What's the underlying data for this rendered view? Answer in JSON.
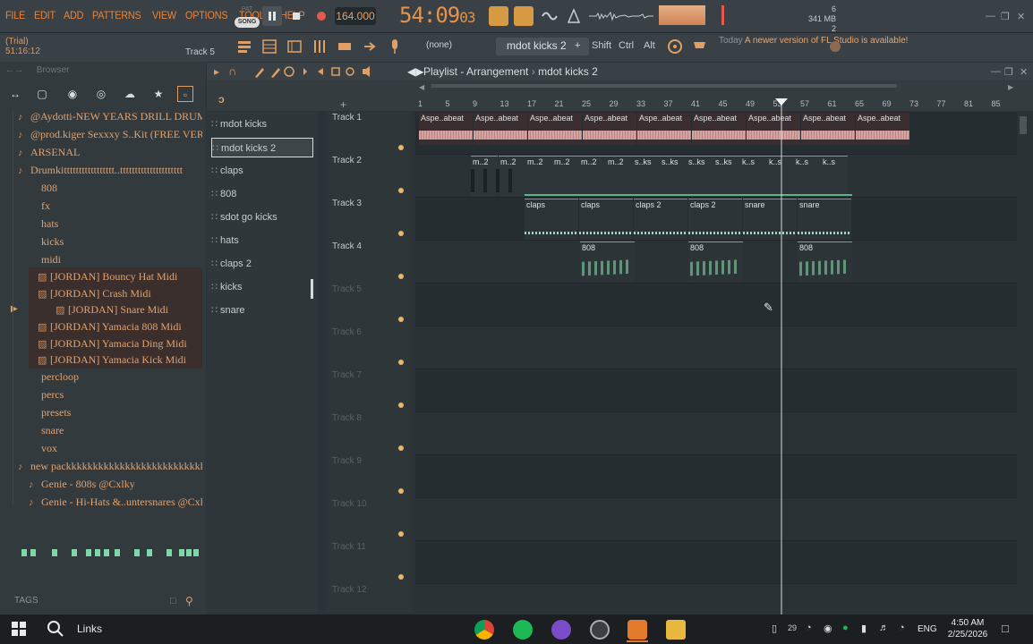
{
  "menu": [
    "FILE",
    "EDIT",
    "ADD",
    "PATTERNS",
    "VIEW",
    "OPTIONS",
    "TOOLS",
    "HELP"
  ],
  "trial": {
    "label": "(Trial)",
    "position": "51:16:12"
  },
  "mode": {
    "pat": "PAT",
    "song": "SONG"
  },
  "tempo": "164.000",
  "time": {
    "main": "54:09",
    "sub": "03"
  },
  "cpu": {
    "cpu_value": "6",
    "memory": "341 MB",
    "polyphony": "2"
  },
  "toolbar": {
    "current_track": "Track 5",
    "none_label": "(none)",
    "pattern_name": "mdot kicks 2",
    "keys": [
      "Shift",
      "Ctrl",
      "Alt"
    ]
  },
  "news": {
    "prefix": "Today",
    "text": "A newer version of FL Studio is available!"
  },
  "browser": {
    "title": "Browser",
    "tags_label": "TAGS",
    "tree": [
      {
        "label": "@Aydotti-NEW YEARS DRILL DRUMKIT",
        "icon": "note-icon",
        "depth": 0
      },
      {
        "label": "@prod.kiger Sexxxy S..Kit (FREE VERSION)",
        "icon": "note-icon",
        "depth": 0
      },
      {
        "label": "ARSENAL",
        "icon": "note-icon",
        "depth": 0
      },
      {
        "label": "Drumkittttttttttttttttt..ttttttttttttttttttttt",
        "icon": "note-icon",
        "depth": 0
      },
      {
        "label": "808",
        "icon": "folder-icon",
        "depth": 1
      },
      {
        "label": "fx",
        "icon": "folder-icon",
        "depth": 1
      },
      {
        "label": "hats",
        "icon": "folder-icon",
        "depth": 1
      },
      {
        "label": "kicks",
        "icon": "folder-icon",
        "depth": 1
      },
      {
        "label": "midi",
        "icon": "folder-icon",
        "depth": 1
      },
      {
        "label": "[JORDAN] Bouncy Hat Midi",
        "icon": "midi-icon",
        "depth": 2
      },
      {
        "label": "[JORDAN] Crash Midi",
        "icon": "midi-icon",
        "depth": 2
      },
      {
        "label": "[JORDAN] Snare Midi",
        "icon": "midi-icon",
        "depth": 2,
        "selected": true
      },
      {
        "label": "[JORDAN] Yamacia 808 Midi",
        "icon": "midi-icon",
        "depth": 2
      },
      {
        "label": "[JORDAN] Yamacia Ding Midi",
        "icon": "midi-icon",
        "depth": 2
      },
      {
        "label": "[JORDAN] Yamacia Kick Midi",
        "icon": "midi-icon",
        "depth": 2
      },
      {
        "label": "percloop",
        "icon": "folder-icon",
        "depth": 1
      },
      {
        "label": "percs",
        "icon": "folder-icon",
        "depth": 1
      },
      {
        "label": "presets",
        "icon": "folder-icon",
        "depth": 1
      },
      {
        "label": "snare",
        "icon": "folder-icon",
        "depth": 1
      },
      {
        "label": "vox",
        "icon": "folder-icon",
        "depth": 1
      },
      {
        "label": "new packkkkkkkkkkkkkkkkkkkkkkkkkkk",
        "icon": "note-icon",
        "depth": 0
      },
      {
        "label": "Genie - 808s @Cxlky",
        "icon": "note-icon",
        "depth": 1
      },
      {
        "label": "Genie - Hi-Hats &..untersnares @Cxlky",
        "icon": "note-icon",
        "depth": 1
      }
    ]
  },
  "picker": [
    {
      "label": "mdot kicks"
    },
    {
      "label": "mdot kicks 2",
      "selected": true
    },
    {
      "label": "claps"
    },
    {
      "label": "808"
    },
    {
      "label": "sdot go kicks"
    },
    {
      "label": "hats"
    },
    {
      "label": "claps 2"
    },
    {
      "label": "kicks"
    },
    {
      "label": "snare"
    }
  ],
  "playlist": {
    "title": "Playlist - Arrangement",
    "pattern": "mdot kicks 2",
    "ruler": [
      "1",
      "5",
      "9",
      "13",
      "17",
      "21",
      "25",
      "29",
      "33",
      "37",
      "41",
      "45",
      "49",
      "53",
      "57",
      "61",
      "65",
      "69",
      "73",
      "77",
      "81",
      "85"
    ],
    "tracks": [
      "Track 1",
      "Track 2",
      "Track 3",
      "Track 4",
      "Track 5",
      "Track 6",
      "Track 7",
      "Track 8",
      "Track 9",
      "Track 10",
      "Track 11",
      "Track 12"
    ],
    "clip_labels": {
      "audio": "Aspe..abeat",
      "mdot": "m..2",
      "sks": "s..ks",
      "ks": "k..s",
      "claps": "claps",
      "claps2": "claps 2",
      "snare": "snare",
      "b808": "808"
    }
  },
  "taskbar": {
    "search_label": "Links",
    "time": "4:50 AM",
    "date": "2/25/2026",
    "lang": "ENG",
    "notif": "29"
  },
  "colors": {
    "accent": "#e8833a",
    "audio_clip": "#d4a3a0",
    "note_clip": "#7fd6a8"
  }
}
